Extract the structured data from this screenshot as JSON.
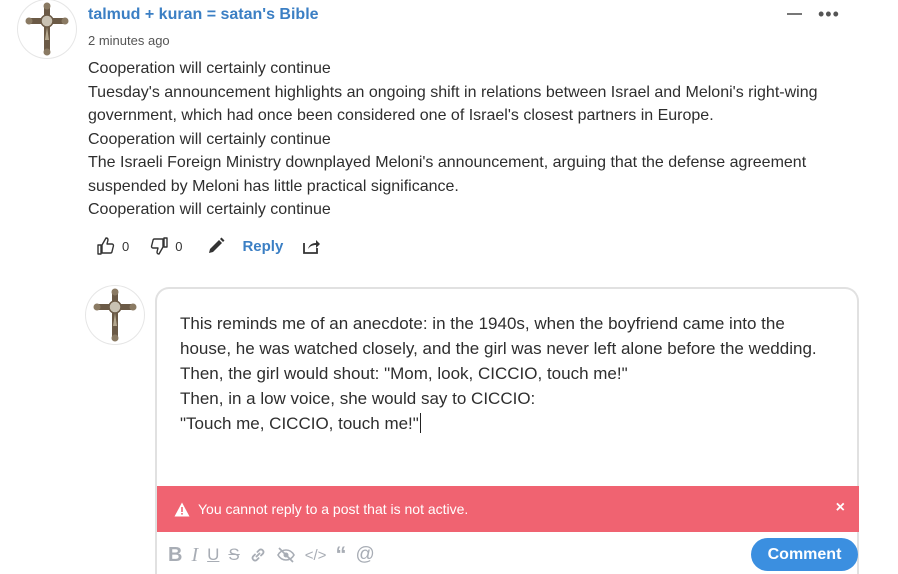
{
  "comment": {
    "author": "talmud + kuran = satan's Bible",
    "time": "2 minutes ago",
    "paragraphs": [
      "Cooperation will certainly continue",
      "Tuesday's announcement highlights an ongoing shift in relations between Israel and Meloni's right-wing government, which had once been considered one of Israel's closest partners in Europe.",
      "Cooperation will certainly continue",
      "The Israeli Foreign Ministry downplayed Meloni's announcement, arguing that the defense agreement suspended by Meloni has little practical significance.",
      "Cooperation will certainly continue"
    ],
    "upvotes": "0",
    "downvotes": "0",
    "reply_label": "Reply"
  },
  "reply": {
    "lines": [
      "This reminds me of an anecdote: in the 1940s, when the boyfriend came into the house, he was watched closely, and the girl was never left alone before the wedding.",
      "Then, the girl would shout: \"Mom, look, CICCIO, touch me!\"",
      "Then, in a low voice, she would say to CICCIO:",
      "\"Touch me, CICCIO, touch me!\""
    ],
    "alert": "You cannot reply to a post that is not active.",
    "comment_button": "Comment"
  },
  "icons": [
    "crucifix-avatar",
    "minimize-icon",
    "more-icon",
    "thumbs-up-icon",
    "thumbs-down-icon",
    "edit-icon",
    "share-icon",
    "warning-icon",
    "close-icon",
    "bold-icon",
    "italic-icon",
    "underline-icon",
    "strikethrough-icon",
    "link-icon",
    "spoiler-icon",
    "code-icon",
    "quote-icon",
    "mention-icon"
  ],
  "colors": {
    "accent": "#3b7fc4",
    "button": "#3b8fe0",
    "alert": "#f06371"
  }
}
